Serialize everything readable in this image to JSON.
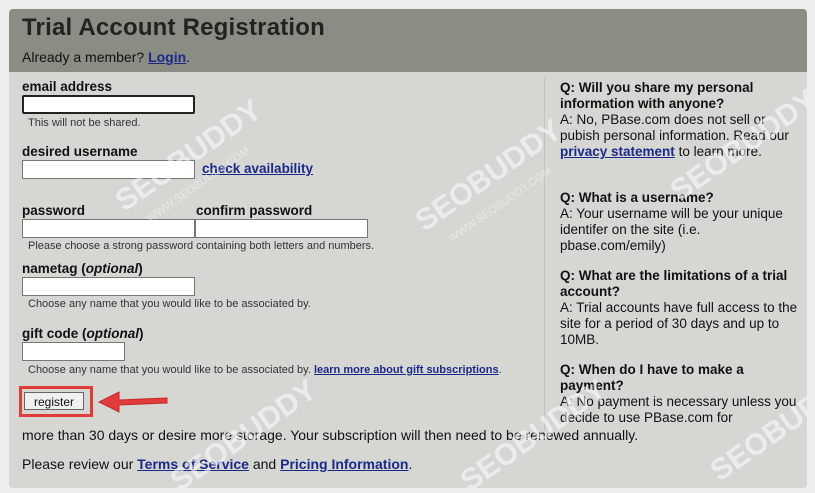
{
  "header": {
    "title": "Trial Account Registration",
    "member_prefix": "Already a member?",
    "login_link": "Login",
    "member_suffix": "."
  },
  "form": {
    "email_label": "email address",
    "email_hint": "This will not be shared.",
    "username_label": "desired username",
    "check_availability": "check availability",
    "password_label": "password",
    "confirm_password_label": "confirm password",
    "password_hint": "Please choose a strong password containing both letters and numbers.",
    "nametag_label": "nametag",
    "optional": "optional",
    "nametag_hint": "Choose any name that you would like to be associated by.",
    "giftcode_label": "gift code",
    "giftcode_hint": "Choose any name that you would like to be associated by.",
    "gift_link": "learn more about gift subscriptions",
    "register_button": "register"
  },
  "faq": [
    {
      "q": "Q: Will you share my personal information with anyone?",
      "a_prefix": "A: No, PBase.com does not sell or pubish personal information. Read our ",
      "link": "privacy statement",
      "a_suffix": " to learn more."
    },
    {
      "q": "Q: What is a username?",
      "a": "A: Your username will be your unique identifer on the site (i.e. pbase.com/emily)"
    },
    {
      "q": "Q: What are the limitations of a trial account?",
      "a": "A: Trial accounts have full access to the site for a period of 30 days and up to 10MB."
    },
    {
      "q": "Q: When do I have to make a payment?",
      "a": "A: No payment is necessary unless you decide to use PBase.com for"
    }
  ],
  "bottom": {
    "continuation": "more than 30 days or desire more storage. Your subscription will then need to be renewed annually.",
    "review_prefix": "Please review our ",
    "terms_link": "Terms of Service",
    "and": " and ",
    "pricing_link": "Pricing Information",
    "end": "."
  },
  "watermark": {
    "brand": "SEOBUDDY",
    "site": "WWW.SEOBUDDY.COM"
  },
  "colors": {
    "header_bg": "#8b8d85",
    "panel_bg": "#d6d7d2",
    "link": "#1a2a8a",
    "highlight": "#e23b3b"
  }
}
